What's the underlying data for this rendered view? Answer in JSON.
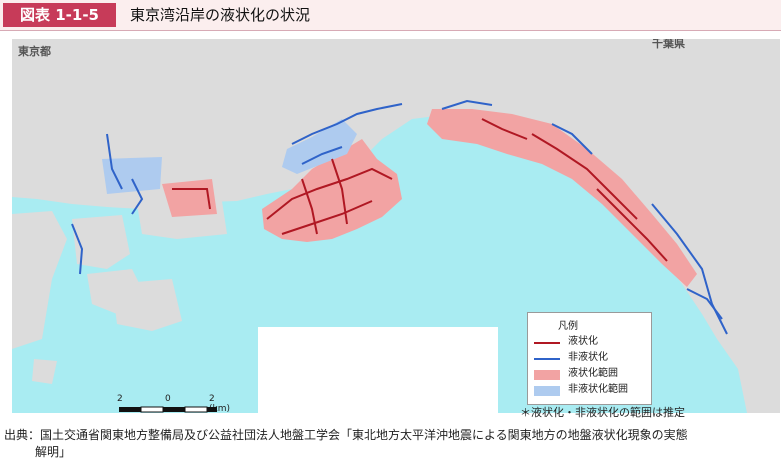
{
  "header": {
    "figure_number": "図表 1-1-5",
    "title": "東京湾沿岸の液状化の状況",
    "accent_color": "#c73b59",
    "band_color": "#fbeeee"
  },
  "map": {
    "region_labels": {
      "tokyo": "東京都",
      "chiba": "千葉県"
    },
    "colors": {
      "sea": "#a9ecf2",
      "land": "#dcdcdc",
      "liquefaction_line": "#b01823",
      "non_liquefaction_line": "#2f63c9",
      "liquefaction_area": "#f2a3a3",
      "non_liquefaction_area": "#aecbef"
    }
  },
  "legend": {
    "title": "凡例",
    "items": [
      {
        "label": "液状化",
        "kind": "line",
        "color": "#b01823"
      },
      {
        "label": "非液状化",
        "kind": "line",
        "color": "#2f63c9"
      },
      {
        "label": "液状化範囲",
        "kind": "area",
        "color": "#f2a3a3"
      },
      {
        "label": "非液状化範囲",
        "kind": "area",
        "color": "#aecbef"
      }
    ]
  },
  "scale_bar": {
    "left": "2",
    "center": "0",
    "right": "2 (km)"
  },
  "note": "＊液状化・非液状化の範囲は推定",
  "source": {
    "line1": "出典：国土交通省関東地方整備局及び公益社団法人地盤工学会「東北地方太平洋沖地震による関東地方の地盤液状化現象の実態",
    "line2": "解明」"
  }
}
